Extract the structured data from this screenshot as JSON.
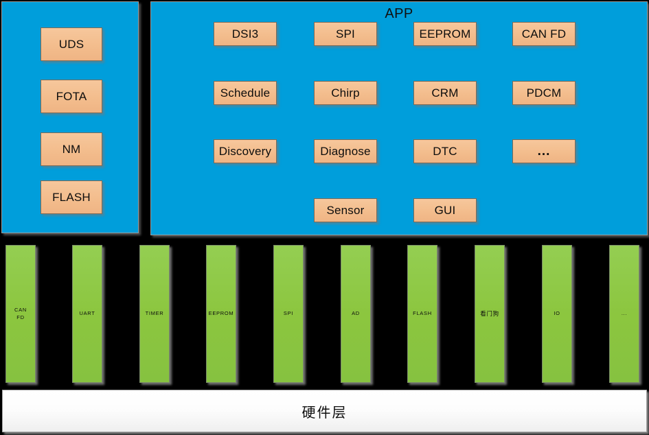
{
  "diagram": {
    "title_app": "APP",
    "hardware_layer_label": "硬件层",
    "colors": {
      "panel_blue": "#009EDB",
      "module_orange": "#F3BD8D",
      "driver_green": "#8CC63F",
      "hardware_bar": "#FFFFFF",
      "background": "#000000"
    }
  },
  "services_panel": {
    "items": [
      {
        "label": "UDS"
      },
      {
        "label": "FOTA"
      },
      {
        "label": "NM"
      },
      {
        "label": "FLASH"
      }
    ]
  },
  "app_panel": {
    "title": "APP",
    "modules": [
      {
        "label": "DSI3"
      },
      {
        "label": "SPI"
      },
      {
        "label": "EEPROM"
      },
      {
        "label": "CAN FD"
      },
      {
        "label": "Schedule"
      },
      {
        "label": "Chirp"
      },
      {
        "label": "CRM"
      },
      {
        "label": "PDCM"
      },
      {
        "label": "Discovery"
      },
      {
        "label": "Diagnose"
      },
      {
        "label": "DTC"
      },
      {
        "label": "..."
      },
      {
        "label": "Sensor"
      },
      {
        "label": "GUI"
      }
    ]
  },
  "driver_layer": {
    "drivers": [
      {
        "line1": "CAN",
        "line2": "FD"
      },
      {
        "line1": "UART",
        "line2": ""
      },
      {
        "line1": "TIMER",
        "line2": ""
      },
      {
        "line1": "EEPROM",
        "line2": ""
      },
      {
        "line1": "SPI",
        "line2": ""
      },
      {
        "line1": "AD",
        "line2": ""
      },
      {
        "line1": "FLASH",
        "line2": ""
      },
      {
        "line1": "看门狗",
        "line2": ""
      },
      {
        "line1": "IO",
        "line2": ""
      },
      {
        "line1": "...",
        "line2": ""
      }
    ]
  },
  "hardware_layer": {
    "label": "硬件层"
  }
}
